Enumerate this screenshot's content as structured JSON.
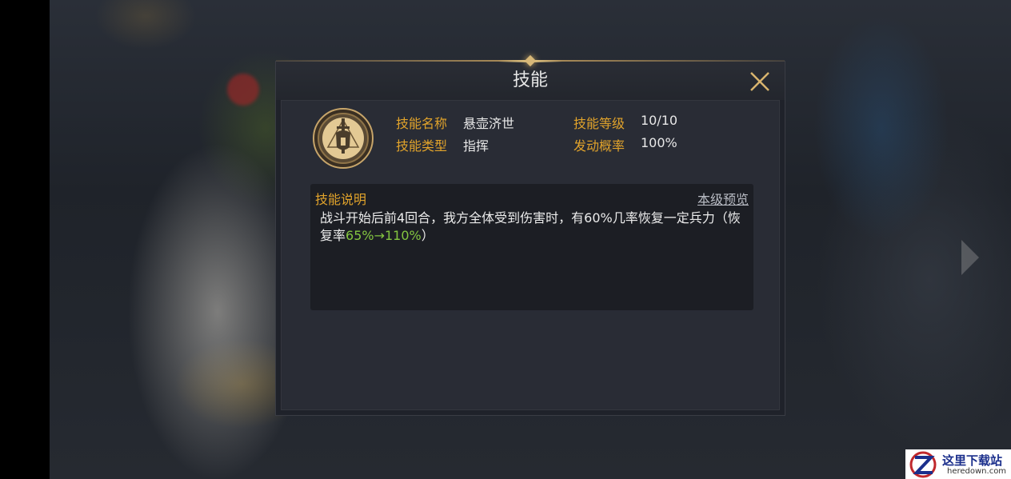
{
  "dialog": {
    "title": "技能",
    "close_icon": "close-x-icon"
  },
  "skill": {
    "icon": "sword-shield-icon",
    "name_label": "技能名称",
    "name_value": "悬壶济世",
    "type_label": "技能类型",
    "type_value": "指挥",
    "level_label": "技能等级",
    "level_value": "10/10",
    "rate_label": "发动概率",
    "rate_value": "100%"
  },
  "description": {
    "title": "技能说明",
    "preview_link": "本级预览",
    "text_main": "战斗开始后前4回合，我方全体受到伤害时，有60%几率恢复一定兵力（恢复率",
    "text_highlight": "65%→110%",
    "text_end": "）"
  },
  "colors": {
    "label_gold": "#e1a32b",
    "highlight_green": "#83c540",
    "dialog_bg": "#1f222a"
  },
  "watermark": {
    "main": "这里下载站",
    "sub": "heredown.com"
  }
}
